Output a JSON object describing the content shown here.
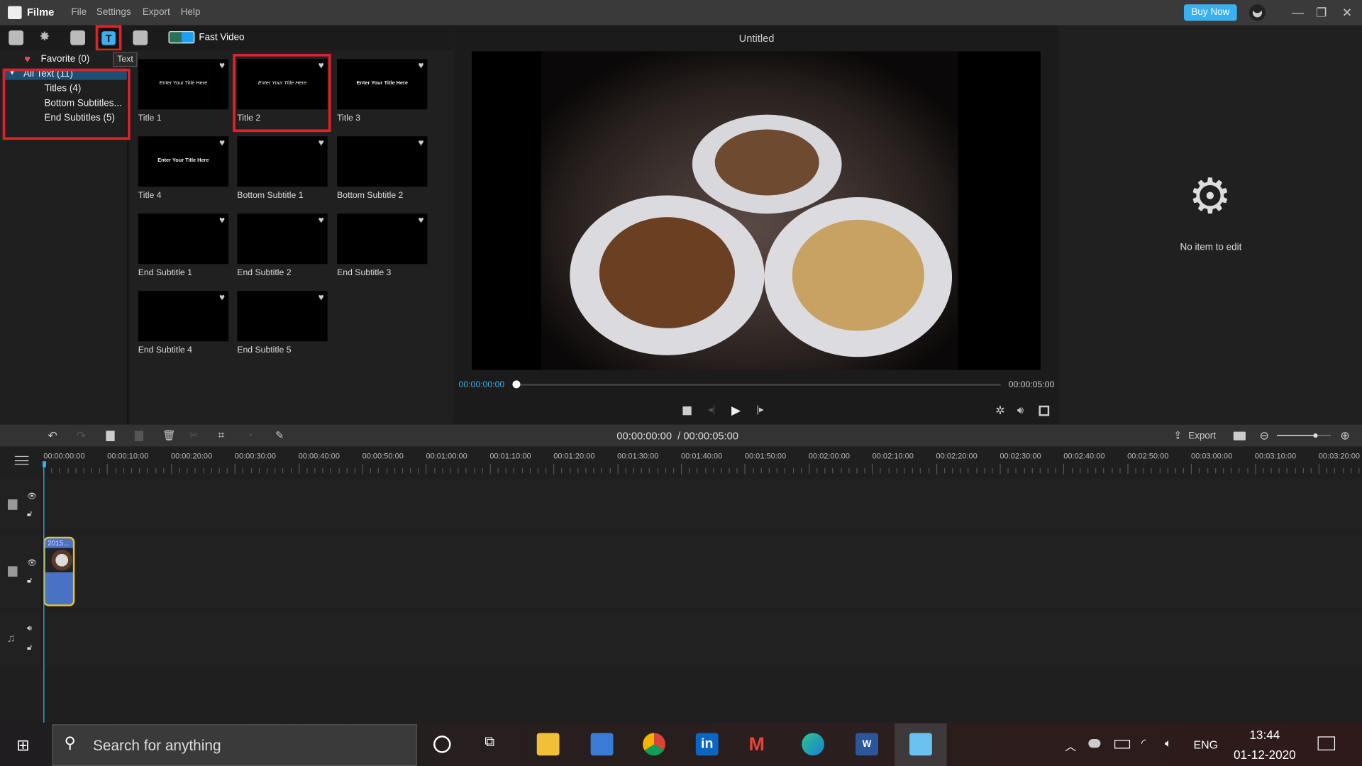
{
  "app": {
    "name": "Filme",
    "menu": [
      "File",
      "Settings",
      "Export",
      "Help"
    ],
    "buy_now": "Buy Now",
    "project_title": "Untitled"
  },
  "toolbar": {
    "tabs": [
      "media",
      "effects",
      "transitions",
      "text",
      "music"
    ],
    "active": "text",
    "tooltip": "Text",
    "fast_video": "Fast Video"
  },
  "categories": {
    "favorite": "Favorite (0)",
    "all_text": "All Text (11)",
    "items": [
      "Titles (4)",
      "Bottom Subtitles...",
      "End Subtitles (5)"
    ]
  },
  "templates": [
    {
      "label": "Title 1",
      "preview": "Enter Your Title Here"
    },
    {
      "label": "Title 2",
      "preview": "Enter Your Title Here"
    },
    {
      "label": "Title 3",
      "preview": "Enter Your Title Here"
    },
    {
      "label": "Title 4",
      "preview": "Enter Your Title Here"
    },
    {
      "label": "Bottom Subtitle 1",
      "preview": ""
    },
    {
      "label": "Bottom Subtitle 2",
      "preview": ""
    },
    {
      "label": "End Subtitle 1",
      "preview": ""
    },
    {
      "label": "End Subtitle 2",
      "preview": ""
    },
    {
      "label": "End Subtitle 3",
      "preview": ""
    },
    {
      "label": "End Subtitle 4",
      "preview": ""
    },
    {
      "label": "End Subtitle 5",
      "preview": ""
    }
  ],
  "player": {
    "current": "00:00:00:00",
    "total": "00:00:05:00",
    "progress": 0
  },
  "properties": {
    "empty": "No item to edit"
  },
  "timeline": {
    "timecode": "00:00:00:00  / 00:00:05:00",
    "export": "Export",
    "zoom_level": 0.7,
    "ruler": [
      "00:00:00:00",
      "00:00:10:00",
      "00:00:20:00",
      "00:00:30:00",
      "00:00:40:00",
      "00:00:50:00",
      "00:01:00:00",
      "00:01:10:00",
      "00:01:20:00",
      "00:01:30:00",
      "00:01:40:00",
      "00:01:50:00",
      "00:02:00:00",
      "00:02:10:00",
      "00:02:20:00",
      "00:02:30:00",
      "00:02:40:00",
      "00:02:50:00",
      "00:03:00:00",
      "00:03:10:00",
      "00:03:20:00"
    ],
    "clip_label": "2015..."
  },
  "taskbar": {
    "search_placeholder": "Search for anything",
    "lang": "ENG",
    "time": "13:44",
    "date": "01-12-2020"
  },
  "colors": {
    "accent": "#3bb0f0",
    "highlight": "#e3202a",
    "clip": "#4a72c4"
  }
}
